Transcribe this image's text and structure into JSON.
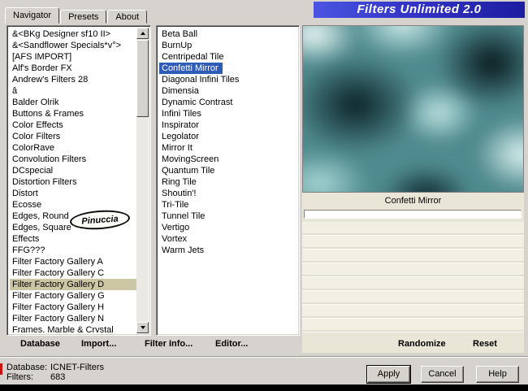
{
  "banner": {
    "title": "Filters Unlimited 2.0"
  },
  "tabs": [
    {
      "label": "Navigator",
      "active": true
    },
    {
      "label": "Presets",
      "active": false
    },
    {
      "label": "About",
      "active": false
    }
  ],
  "categories": {
    "items": [
      "&<BKg Designer sf10 II>",
      "&<Sandflower Specials*v°>",
      "[AFS IMPORT]",
      "Alf's Border FX",
      "Andrew's Filters 28",
      "â",
      "Balder Olrik",
      "Buttons & Frames",
      "Color Effects",
      "Color Filters",
      "ColorRave",
      "Convolution Filters",
      "DCspecial",
      "Distortion Filters",
      "Distort",
      "Ecosse",
      "Edges, Round",
      "Edges, Square",
      "Effects",
      "FFG???",
      "Filter Factory Gallery A",
      "Filter Factory Gallery C",
      "Filter Factory Gallery D",
      "Filter Factory Gallery G",
      "Filter Factory Gallery H",
      "Filter Factory Gallery N",
      "Frames, Marble & Crystal"
    ],
    "selected_index": 22,
    "stamp": "Pinuccia"
  },
  "filters": {
    "items": [
      "Beta Ball",
      "BurnUp",
      "Centripedal Tile",
      "Confetti Mirror",
      "Diagonal Infini Tiles",
      "Dimensia",
      "Dynamic Contrast",
      "Infini Tiles",
      "Inspirator",
      "Legolator",
      "Mirror It",
      "MovingScreen",
      "Quantum Tile",
      "Ring Tile",
      "Shoutin'!",
      "Tri-Tile",
      "Tunnel Tile",
      "Vertigo",
      "Vortex",
      "Warm Jets"
    ],
    "selected_index": 3
  },
  "preview": {
    "name": "Confetti Mirror",
    "progress_percent": 0
  },
  "actions": {
    "randomize": "Randomize",
    "reset": "Reset"
  },
  "toolbar": {
    "database": "Database",
    "import": "Import...",
    "filter_info": "Filter Info...",
    "editor": "Editor..."
  },
  "status": {
    "database_label": "Database:",
    "database_value": "ICNET-Filters",
    "filters_label": "Filters:",
    "filters_value": "683"
  },
  "buttons": {
    "apply": "Apply",
    "cancel": "Cancel",
    "help": "Help"
  },
  "colors": {
    "window_bg": "#d6d3ce",
    "selection_blue": "#2f5cb8",
    "selection_tan": "#cdc6a5",
    "banner_blue_left": "#4a55e0",
    "banner_blue_right": "#1d1da0",
    "panel_beige": "#e9e6d7",
    "red_mark": "#cc1111"
  }
}
